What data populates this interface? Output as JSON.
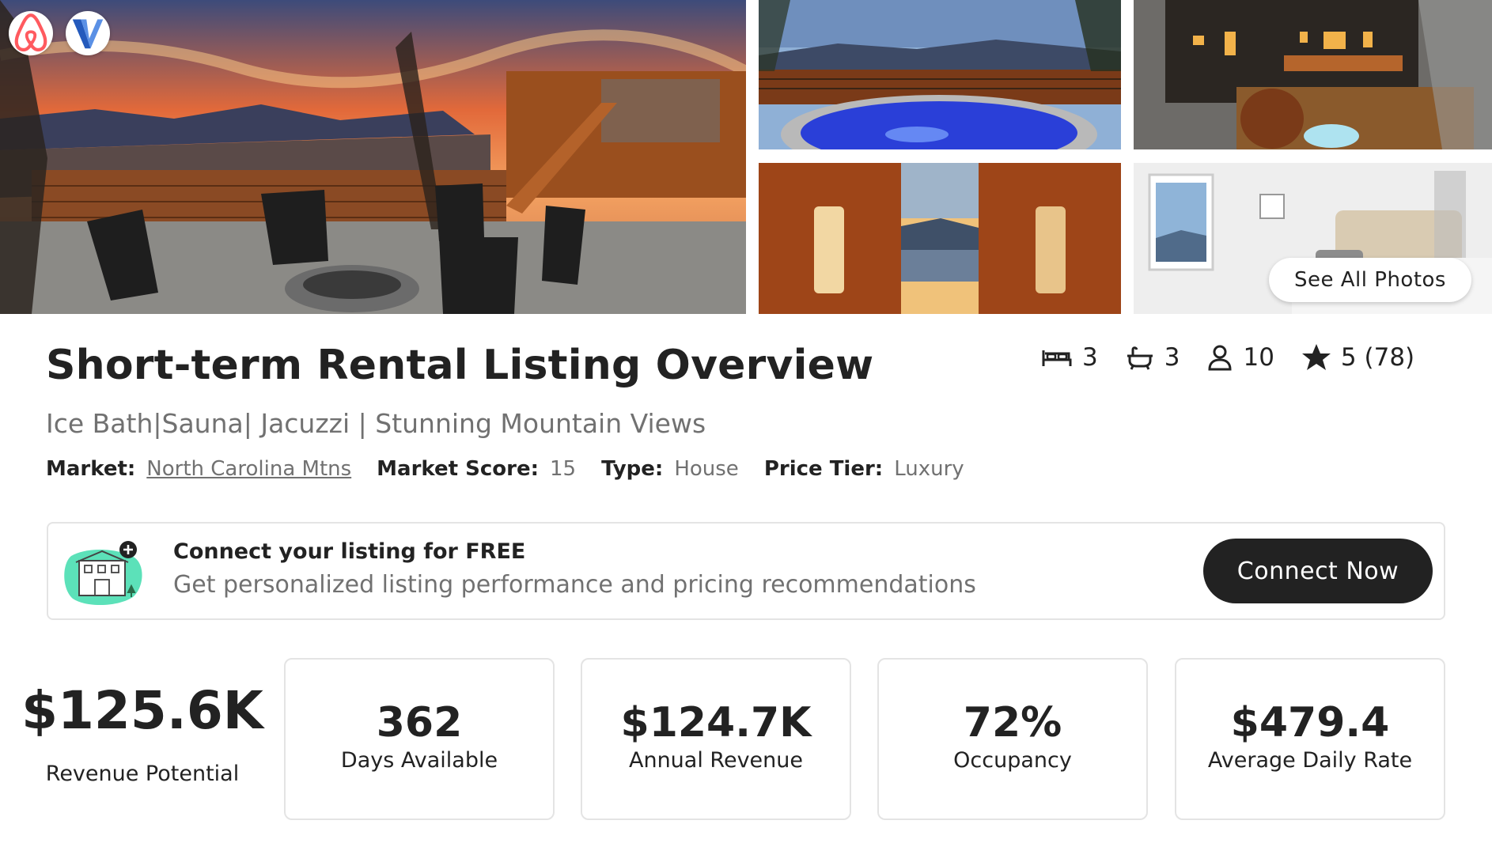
{
  "gallery": {
    "see_all_label": "See All Photos",
    "badges": [
      "airbnb-logo",
      "vrbo-logo"
    ]
  },
  "listing": {
    "title": "Short-term Rental Listing Overview",
    "subtitle": "Ice Bath|Sauna| Jacuzzi | Stunning Mountain Views",
    "market_label": "Market:",
    "market_value": "North Carolina Mtns",
    "market_score_label": "Market Score:",
    "market_score_value": "15",
    "type_label": "Type:",
    "type_value": "House",
    "price_tier_label": "Price Tier:",
    "price_tier_value": "Luxury"
  },
  "stats": {
    "bedrooms": "3",
    "bathrooms": "3",
    "guests": "10",
    "rating": "5 (78)"
  },
  "connect": {
    "heading": "Connect your listing for FREE",
    "description": "Get personalized listing performance and pricing recommendations",
    "button_label": "Connect Now"
  },
  "metrics": {
    "revenue_potential": {
      "value": "$125.6K",
      "label": "Revenue Potential"
    },
    "cards": [
      {
        "value": "362",
        "label": "Days Available"
      },
      {
        "value": "$124.7K",
        "label": "Annual Revenue"
      },
      {
        "value": "72%",
        "label": "Occupancy"
      },
      {
        "value": "$479.4",
        "label": "Average Daily Rate"
      }
    ]
  },
  "colors": {
    "primary_text": "#222222",
    "secondary_text": "#717171",
    "border": "#e4e4e4",
    "button_dark": "#222222",
    "airbnb_brand": "#ff5a5f",
    "illustration_accent": "#5ce1b9"
  }
}
